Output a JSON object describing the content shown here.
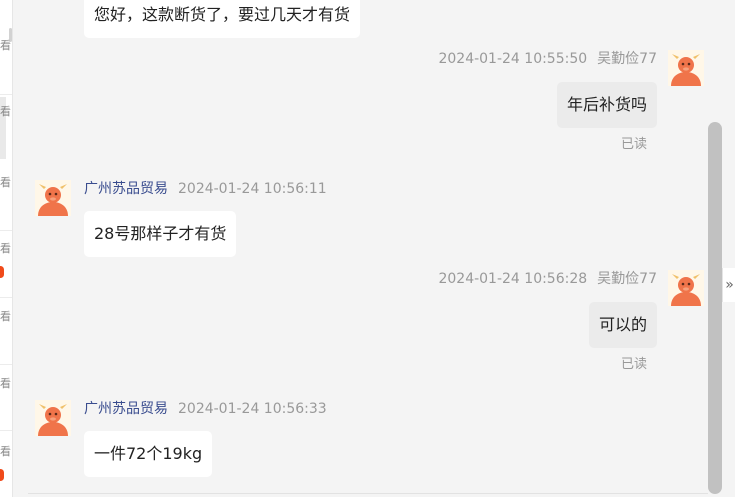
{
  "messages": [
    {
      "side": "other",
      "text": "您好，这款断货了，要过几天才有货"
    },
    {
      "side": "me",
      "sender": "吴勤俭77",
      "time": "2024-01-24 10:55:50",
      "text": "年后补货吗",
      "status": "已读"
    },
    {
      "side": "other",
      "sender": "广州苏品贸易",
      "time": "2024-01-24 10:56:11",
      "text": "28号那样子才有货"
    },
    {
      "side": "me",
      "sender": "吴勤俭77",
      "time": "2024-01-24 10:56:28",
      "text": "可以的",
      "status": "已读"
    },
    {
      "side": "other",
      "sender": "广州苏品贸易",
      "time": "2024-01-24 10:56:33",
      "text": "一件72个19kg"
    }
  ],
  "left_glyphs": [
    "看",
    "看",
    "看",
    "看",
    "看",
    "看",
    "看"
  ],
  "expand_glyph": "»",
  "colors": {
    "sender_name": "#3a4d8f",
    "my_bubble": "#ebebeb",
    "their_bubble": "#ffffff",
    "avatar": "#f0744a"
  }
}
